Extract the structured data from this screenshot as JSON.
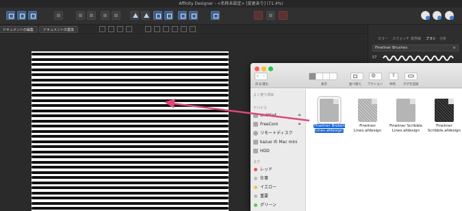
{
  "window": {
    "title": "Affinity Designer - <名称未設定> [変更あり] (71.4%)"
  },
  "context_bar": {
    "btn1": "ドキュメントの編集",
    "btn2": "ドキュメントの置換"
  },
  "panel": {
    "tabs": [
      "カラー",
      "スウォッチ",
      "境界線",
      "ブラシ",
      "分析"
    ],
    "category": "Fineliner Brushes",
    "brush_size": "57"
  },
  "finder": {
    "toolbar_labels": {
      "back": "戻る/進む",
      "view": "表示",
      "arrange": "並べ替え",
      "action": "アクション",
      "share": "共有",
      "tags": "タグを追加"
    },
    "sidebar": {
      "favorites_header": "よく使う項目",
      "devices_header": "デバイス",
      "tags_header": "タグ",
      "devices": [
        "Untitled",
        "FreeCom",
        "リモートディスク",
        "kazuo の Mac mini",
        "HDD"
      ],
      "tags": [
        {
          "label": "レッド",
          "color": "#f0534b"
        },
        {
          "label": "仕事",
          "color": "#b9b9b9"
        },
        {
          "label": "イエロー",
          "color": "#f5c33b"
        },
        {
          "label": "重要",
          "color": "#b9b9b9"
        },
        {
          "label": "グリーン",
          "color": "#5ec64f"
        }
      ]
    },
    "files": [
      {
        "name": "Fineliner Broken Lines.afdesign",
        "selected": true
      },
      {
        "name": "Fineliner Lines.afdesign",
        "selected": false
      },
      {
        "name": "Fineliner Scribble Lines.afdesign",
        "selected": false
      },
      {
        "name": "Fineliner Scribble.afdesign",
        "selected": false
      }
    ]
  },
  "colors": {
    "accent": "#1763d6",
    "drag_arrow": "#e0467c"
  }
}
